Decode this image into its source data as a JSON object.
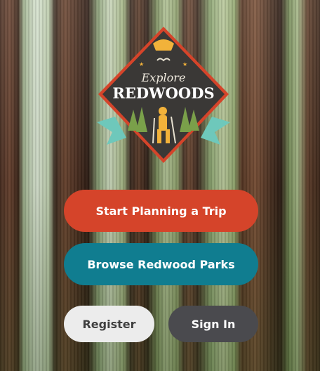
{
  "background": {
    "icon": "redwood-forest-photo"
  },
  "logo": {
    "line1": "Explore",
    "line2": "REDWOODS",
    "icon": "hiker-badge-icon",
    "colors": {
      "diamond": "#3a3836",
      "border": "#d5442a",
      "sun": "#f2b23a",
      "ribbon": "#6ec8bb"
    }
  },
  "actions": {
    "plan_label": "Start Planning a Trip",
    "browse_label": "Browse Redwood Parks",
    "register_label": "Register",
    "signin_label": "Sign In"
  },
  "colors": {
    "plan": "#d5442a",
    "browse": "#107d90",
    "register": "#ececec",
    "signin": "#4a4a4e"
  }
}
